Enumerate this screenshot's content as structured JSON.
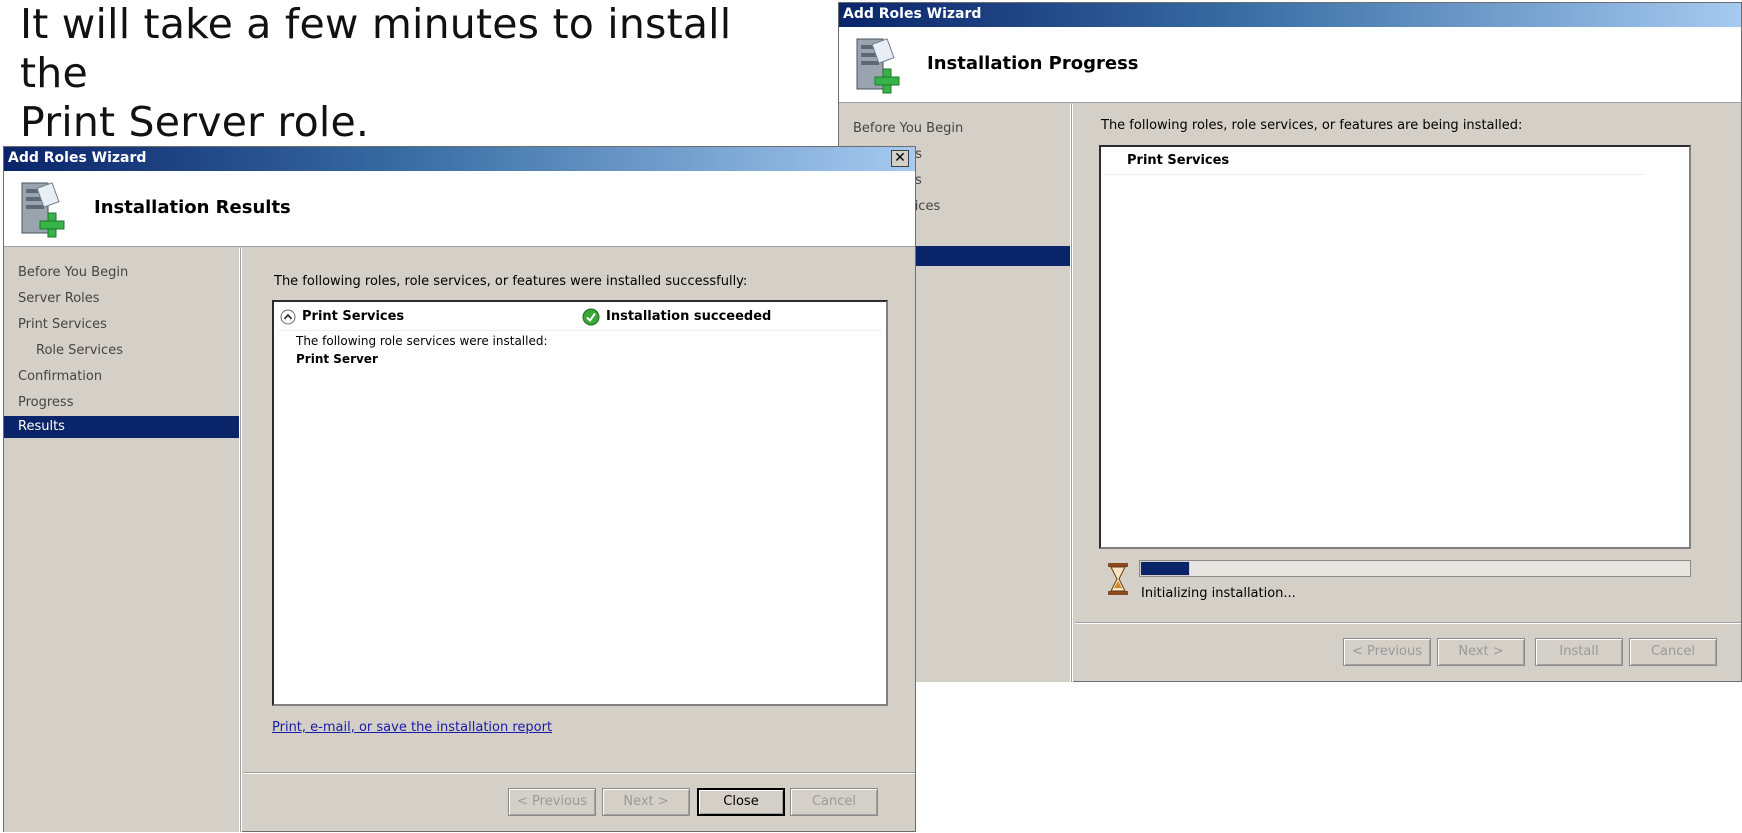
{
  "slide": {
    "line1": "It will take a few minutes to install the",
    "line2": "Print Server role."
  },
  "progress_window": {
    "title": "Add Roles Wizard",
    "header_title": "Installation Progress",
    "nav": [
      {
        "label": "Before You Begin"
      },
      {
        "label": "ds"
      },
      {
        "label": "es"
      },
      {
        "label": "vices"
      },
      {
        "label": "n"
      },
      {
        "label": ""
      }
    ],
    "intro_text": "The following roles, role services, or features are being installed:",
    "list_item": "Print Services",
    "progress_fraction": 0.09,
    "status_text": "Initializing installation...",
    "buttons": {
      "previous": "< Previous",
      "next": "Next >",
      "install": "Install",
      "cancel": "Cancel"
    }
  },
  "results_window": {
    "title": "Add Roles Wizard",
    "close_glyph": "✕",
    "header_title": "Installation Results",
    "nav": [
      {
        "label": "Before You Begin"
      },
      {
        "label": "Server Roles"
      },
      {
        "label": "Print Services"
      },
      {
        "label": "Role Services"
      },
      {
        "label": "Confirmation"
      },
      {
        "label": "Progress"
      },
      {
        "label": "Results"
      }
    ],
    "intro_text": "The following roles, role services, or features were installed successfully:",
    "role_name": "Print Services",
    "status": "Installation succeeded",
    "detail_line": "The following role services were installed:",
    "detail_item": "Print Server",
    "report_link": "Print, e-mail, or save the installation report",
    "buttons": {
      "previous": "< Previous",
      "next": "Next >",
      "close": "Close",
      "cancel": "Cancel"
    }
  },
  "colors": {
    "nav_active": "#0a246a",
    "progress_fill": "#0a246a",
    "success_green": "#3aa63a"
  }
}
